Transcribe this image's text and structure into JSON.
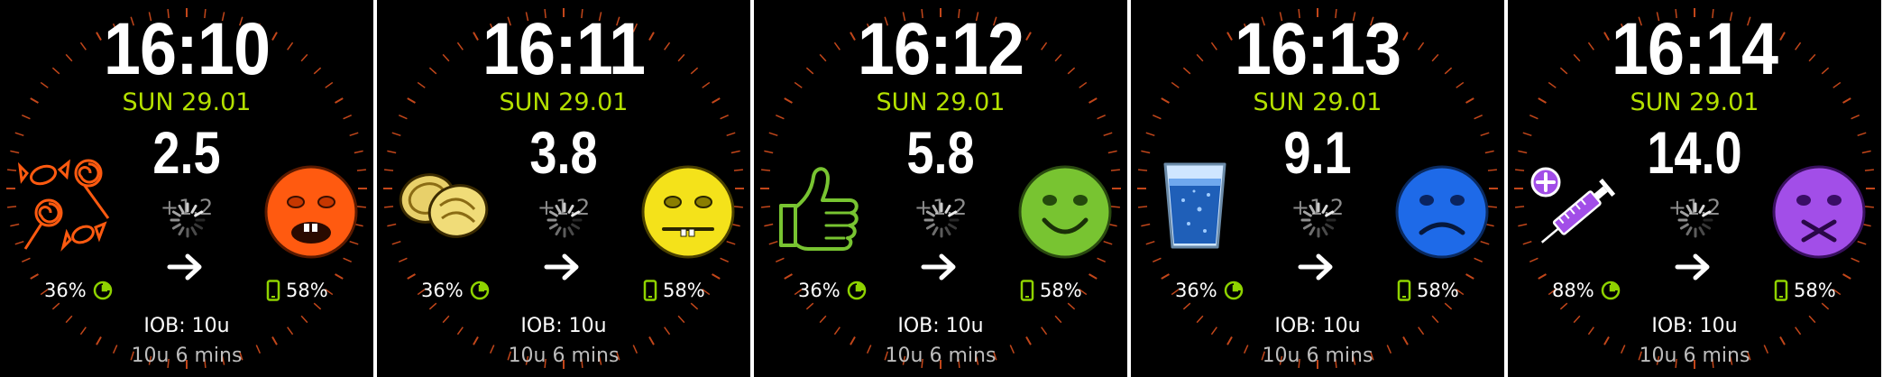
{
  "faces": [
    {
      "time": "16:10",
      "date": "SUN 29.01",
      "bg": "2.5",
      "delta": "+1.2",
      "uploader_battery": "36%",
      "phone_battery": "58%",
      "iob": "IOB: 10u",
      "basal": "10u 6 mins",
      "left_icon": "candy-icon",
      "mood_icon": "scared-face-icon",
      "mood_color": "#ff5a10"
    },
    {
      "time": "16:11",
      "date": "SUN 29.01",
      "bg": "3.8",
      "delta": "+1.2",
      "uploader_battery": "36%",
      "phone_battery": "58%",
      "iob": "IOB: 10u",
      "basal": "10u 6 mins",
      "left_icon": "cookies-icon",
      "mood_icon": "worried-face-icon",
      "mood_color": "#f4e21a"
    },
    {
      "time": "16:12",
      "date": "SUN 29.01",
      "bg": "5.8",
      "delta": "+1.2",
      "uploader_battery": "36%",
      "phone_battery": "58%",
      "iob": "IOB: 10u",
      "basal": "10u 6 mins",
      "left_icon": "thumbs-up-icon",
      "mood_icon": "happy-face-icon",
      "mood_color": "#78c431"
    },
    {
      "time": "16:13",
      "date": "SUN 29.01",
      "bg": "9.1",
      "delta": "+1.2",
      "uploader_battery": "36%",
      "phone_battery": "58%",
      "iob": "IOB: 10u",
      "basal": "10u 6 mins",
      "left_icon": "water-glass-icon",
      "mood_icon": "sad-face-icon",
      "mood_color": "#1e6ae8"
    },
    {
      "time": "16:14",
      "date": "SUN 29.01",
      "bg": "14.0",
      "delta": "+1.2",
      "uploader_battery": "88%",
      "phone_battery": "58%",
      "iob": "IOB: 10u",
      "basal": "10u 6 mins",
      "left_icon": "insulin-syringe-icon",
      "mood_icon": "sick-face-icon",
      "mood_color": "#a24ee8"
    }
  ],
  "colors": {
    "background": "#000000",
    "date": "#b4e000",
    "status_icon": "#8fd300",
    "tick_marks": "#c2461a",
    "delta": "#8c8c8c"
  }
}
